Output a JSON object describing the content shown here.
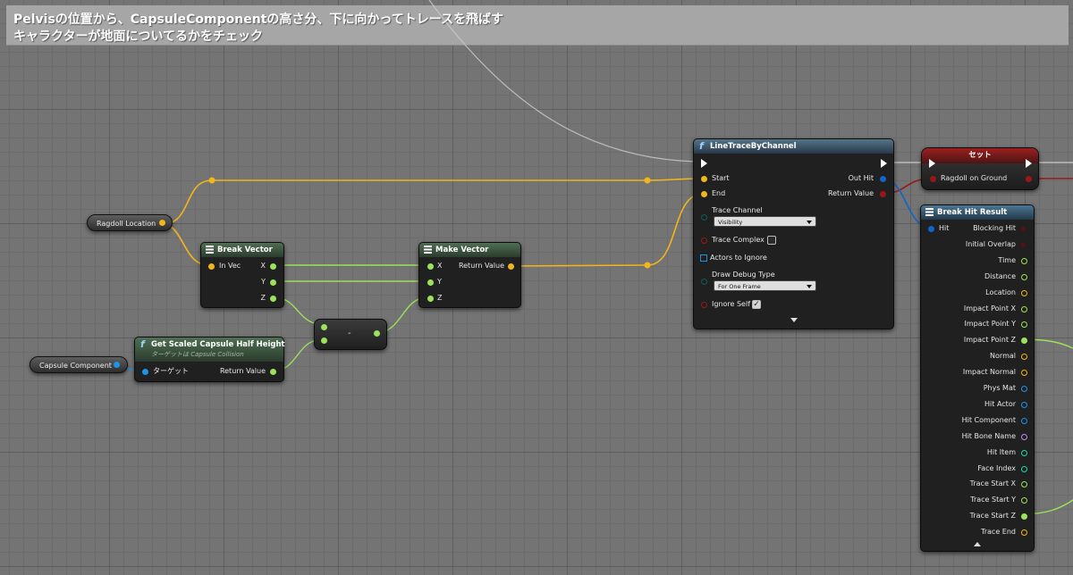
{
  "comment": {
    "line1": "Pelvisの位置から、CapsuleComponentの高さ分、下に向かってトレースを飛ばす",
    "line2": "キャラクターが地面についてるかをチェック"
  },
  "colors": {
    "vector": "#f2b51b",
    "float": "#9ce25a",
    "object": "#1b93e8",
    "struct": "#1065c8",
    "bool": "#9b1616",
    "enum": "#0f5e55",
    "exec": "#ffffff",
    "name": "#c885f0",
    "int": "#1ed7a8"
  },
  "ragdoll_location": {
    "label": "Ragdoll Location"
  },
  "capsule_component": {
    "label": "Capsule Component"
  },
  "break_vector": {
    "title": "Break Vector",
    "in_vec": "In Vec",
    "x": "X",
    "y": "Y",
    "z": "Z"
  },
  "make_vector": {
    "title": "Make Vector",
    "x": "X",
    "y": "Y",
    "z": "Z",
    "return_value": "Return Value"
  },
  "subtract": {
    "symbol": "-"
  },
  "get_scaled": {
    "title": "Get Scaled Capsule Half Height",
    "subtitle": "ターゲットは Capsule Collision",
    "target": "ターゲット",
    "return_value": "Return Value"
  },
  "line_trace": {
    "title": "LineTraceByChannel",
    "start": "Start",
    "end": "End",
    "trace_channel": "Trace Channel",
    "trace_channel_value": "Visibility",
    "trace_complex": "Trace Complex",
    "actors_to_ignore": "Actors to Ignore",
    "draw_debug_type": "Draw Debug Type",
    "draw_debug_value": "For One Frame",
    "ignore_self": "Ignore Self",
    "out_hit": "Out Hit",
    "return_value": "Return Value"
  },
  "set_node": {
    "title": "セット",
    "ragdoll_on_ground": "Ragdoll on Ground"
  },
  "break_hit": {
    "title": "Break Hit Result",
    "hit": "Hit",
    "outputs": [
      "Blocking Hit",
      "Initial Overlap",
      "Time",
      "Distance",
      "Location",
      "Impact Point X",
      "Impact Point Y",
      "Impact Point Z",
      "Normal",
      "Impact Normal",
      "Phys Mat",
      "Hit Actor",
      "Hit Component",
      "Hit Bone Name",
      "Hit Item",
      "Face Index",
      "Trace Start X",
      "Trace Start Y",
      "Trace Start Z",
      "Trace End"
    ]
  }
}
